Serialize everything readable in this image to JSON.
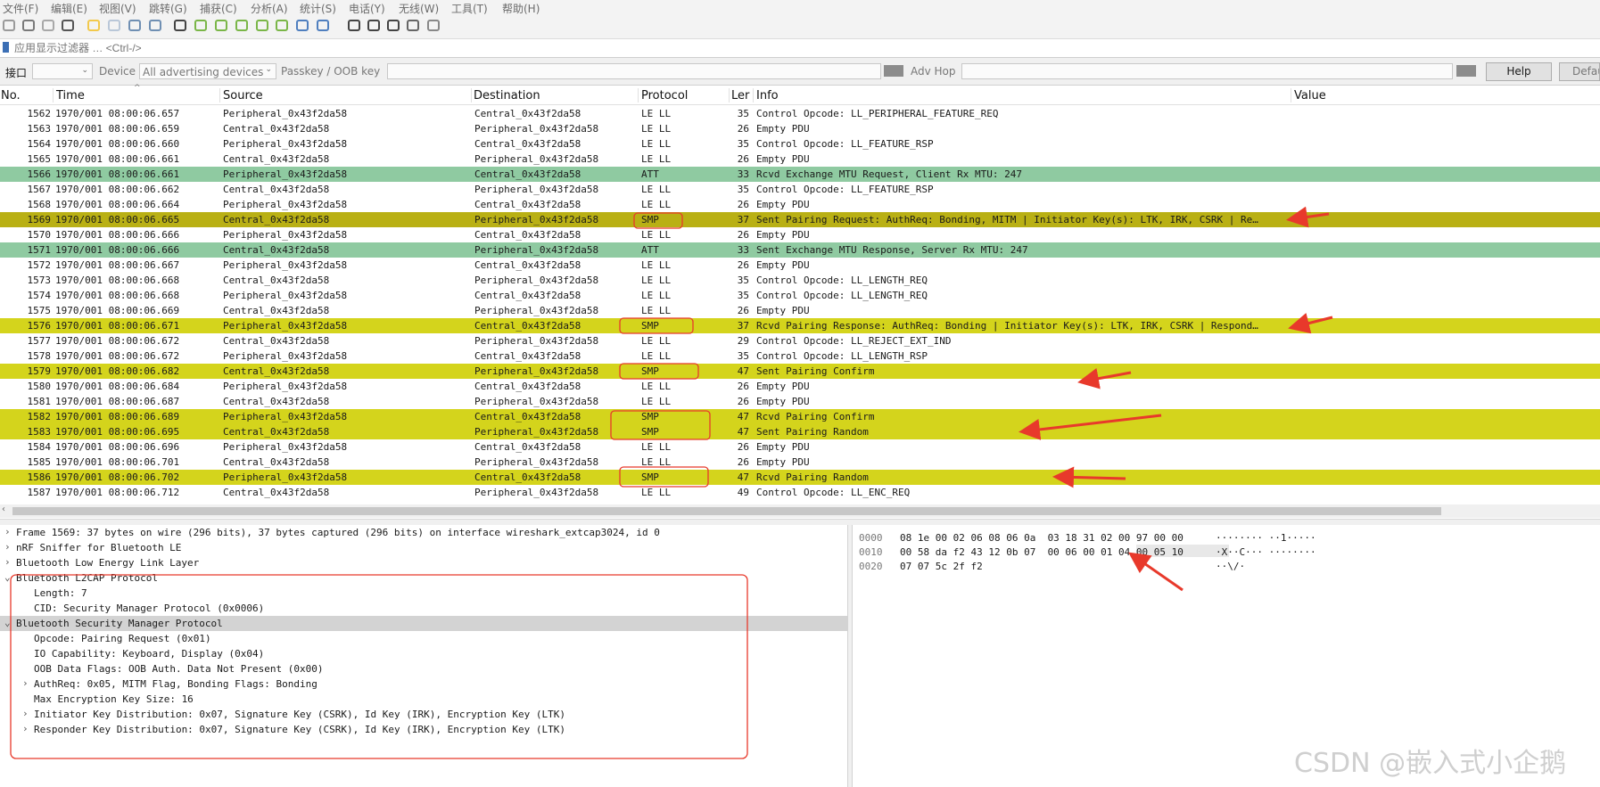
{
  "menu": [
    "文件(F)",
    "编辑(E)",
    "视图(V)",
    "跳转(G)",
    "捕获(C)",
    "分析(A)",
    "统计(S)",
    "电话(Y)",
    "无线(W)",
    "工具(T)",
    "帮助(H)"
  ],
  "toolbar_icons": [
    "start-capture-icon",
    "stop-capture-icon",
    "restart-capture-icon",
    "capture-options-icon",
    "open-file-icon",
    "save-file-icon",
    "close-file-icon",
    "reload-file-icon",
    "find-packet-icon",
    "go-back-icon",
    "go-forward-icon",
    "go-to-packet-icon",
    "first-packet-icon",
    "last-packet-icon",
    "autoscroll-icon",
    "colorize-icon",
    "zoom-in-icon",
    "zoom-out-icon",
    "zoom-normal-icon",
    "resize-columns-icon",
    "layout-icon"
  ],
  "filter": {
    "placeholder": "应用显示过滤器 … <Ctrl-/>"
  },
  "interface_bar": {
    "interface_label": "接口",
    "device_label": "Device",
    "device_value": "All advertising devices",
    "passkey_label": "Passkey / OOB key",
    "adv_hop_label": "Adv Hop",
    "help_label": "Help",
    "default_label": "Defau"
  },
  "columns": {
    "no": "No.",
    "time": "Time",
    "source": "Source",
    "destination": "Destination",
    "protocol": "Protocol",
    "length": "Ler",
    "info": "Info",
    "value": "Value"
  },
  "packets": [
    {
      "no": "1562",
      "time": "1970/001 08:00:06.657",
      "src": "Peripheral_0x43f2da58",
      "dst": "Central_0x43f2da58",
      "proto": "LE LL",
      "len": "35",
      "info": "Control Opcode: LL_PERIPHERAL_FEATURE_REQ",
      "color": "white"
    },
    {
      "no": "1563",
      "time": "1970/001 08:00:06.659",
      "src": "Central_0x43f2da58",
      "dst": "Peripheral_0x43f2da58",
      "proto": "LE LL",
      "len": "26",
      "info": "Empty PDU",
      "color": "white"
    },
    {
      "no": "1564",
      "time": "1970/001 08:00:06.660",
      "src": "Peripheral_0x43f2da58",
      "dst": "Central_0x43f2da58",
      "proto": "LE LL",
      "len": "35",
      "info": "Control Opcode: LL_FEATURE_RSP",
      "color": "white"
    },
    {
      "no": "1565",
      "time": "1970/001 08:00:06.661",
      "src": "Central_0x43f2da58",
      "dst": "Peripheral_0x43f2da58",
      "proto": "LE LL",
      "len": "26",
      "info": "Empty PDU",
      "color": "white"
    },
    {
      "no": "1566",
      "time": "1970/001 08:00:06.661",
      "src": "Peripheral_0x43f2da58",
      "dst": "Central_0x43f2da58",
      "proto": "ATT",
      "len": "33",
      "info": "Rcvd Exchange MTU Request, Client Rx MTU: 247",
      "color": "att"
    },
    {
      "no": "1567",
      "time": "1970/001 08:00:06.662",
      "src": "Central_0x43f2da58",
      "dst": "Peripheral_0x43f2da58",
      "proto": "LE LL",
      "len": "35",
      "info": "Control Opcode: LL_FEATURE_RSP",
      "color": "white"
    },
    {
      "no": "1568",
      "time": "1970/001 08:00:06.664",
      "src": "Peripheral_0x43f2da58",
      "dst": "Central_0x43f2da58",
      "proto": "LE LL",
      "len": "26",
      "info": "Empty PDU",
      "color": "white"
    },
    {
      "no": "1569",
      "time": "1970/001 08:00:06.665",
      "src": "Central_0x43f2da58",
      "dst": "Peripheral_0x43f2da58",
      "proto": "SMP",
      "len": "37",
      "info": "Sent Pairing Request: AuthReq: Bonding, MITM | Initiator Key(s): LTK, IRK, CSRK | Re…",
      "color": "sel"
    },
    {
      "no": "1570",
      "time": "1970/001 08:00:06.666",
      "src": "Peripheral_0x43f2da58",
      "dst": "Central_0x43f2da58",
      "proto": "LE LL",
      "len": "26",
      "info": "Empty PDU",
      "color": "white"
    },
    {
      "no": "1571",
      "time": "1970/001 08:00:06.666",
      "src": "Central_0x43f2da58",
      "dst": "Peripheral_0x43f2da58",
      "proto": "ATT",
      "len": "33",
      "info": "Sent Exchange MTU Response, Server Rx MTU: 247",
      "color": "att"
    },
    {
      "no": "1572",
      "time": "1970/001 08:00:06.667",
      "src": "Peripheral_0x43f2da58",
      "dst": "Central_0x43f2da58",
      "proto": "LE LL",
      "len": "26",
      "info": "Empty PDU",
      "color": "white"
    },
    {
      "no": "1573",
      "time": "1970/001 08:00:06.668",
      "src": "Central_0x43f2da58",
      "dst": "Peripheral_0x43f2da58",
      "proto": "LE LL",
      "len": "35",
      "info": "Control Opcode: LL_LENGTH_REQ",
      "color": "white"
    },
    {
      "no": "1574",
      "time": "1970/001 08:00:06.668",
      "src": "Peripheral_0x43f2da58",
      "dst": "Central_0x43f2da58",
      "proto": "LE LL",
      "len": "35",
      "info": "Control Opcode: LL_LENGTH_REQ",
      "color": "white"
    },
    {
      "no": "1575",
      "time": "1970/001 08:00:06.669",
      "src": "Central_0x43f2da58",
      "dst": "Peripheral_0x43f2da58",
      "proto": "LE LL",
      "len": "26",
      "info": "Empty PDU",
      "color": "white"
    },
    {
      "no": "1576",
      "time": "1970/001 08:00:06.671",
      "src": "Peripheral_0x43f2da58",
      "dst": "Central_0x43f2da58",
      "proto": "SMP",
      "len": "37",
      "info": "Rcvd Pairing Response: AuthReq: Bonding | Initiator Key(s): LTK, IRK, CSRK | Respond…",
      "color": "smp"
    },
    {
      "no": "1577",
      "time": "1970/001 08:00:06.672",
      "src": "Central_0x43f2da58",
      "dst": "Peripheral_0x43f2da58",
      "proto": "LE LL",
      "len": "29",
      "info": "Control Opcode: LL_REJECT_EXT_IND",
      "color": "white"
    },
    {
      "no": "1578",
      "time": "1970/001 08:00:06.672",
      "src": "Peripheral_0x43f2da58",
      "dst": "Central_0x43f2da58",
      "proto": "LE LL",
      "len": "35",
      "info": "Control Opcode: LL_LENGTH_RSP",
      "color": "white"
    },
    {
      "no": "1579",
      "time": "1970/001 08:00:06.682",
      "src": "Central_0x43f2da58",
      "dst": "Peripheral_0x43f2da58",
      "proto": "SMP",
      "len": "47",
      "info": "Sent Pairing Confirm",
      "color": "smp"
    },
    {
      "no": "1580",
      "time": "1970/001 08:00:06.684",
      "src": "Peripheral_0x43f2da58",
      "dst": "Central_0x43f2da58",
      "proto": "LE LL",
      "len": "26",
      "info": "Empty PDU",
      "color": "white"
    },
    {
      "no": "1581",
      "time": "1970/001 08:00:06.687",
      "src": "Central_0x43f2da58",
      "dst": "Peripheral_0x43f2da58",
      "proto": "LE LL",
      "len": "26",
      "info": "Empty PDU",
      "color": "white"
    },
    {
      "no": "1582",
      "time": "1970/001 08:00:06.689",
      "src": "Peripheral_0x43f2da58",
      "dst": "Central_0x43f2da58",
      "proto": "SMP",
      "len": "47",
      "info": "Rcvd Pairing Confirm",
      "color": "smp"
    },
    {
      "no": "1583",
      "time": "1970/001 08:00:06.695",
      "src": "Central_0x43f2da58",
      "dst": "Peripheral_0x43f2da58",
      "proto": "SMP",
      "len": "47",
      "info": "Sent Pairing Random",
      "color": "smp"
    },
    {
      "no": "1584",
      "time": "1970/001 08:00:06.696",
      "src": "Peripheral_0x43f2da58",
      "dst": "Central_0x43f2da58",
      "proto": "LE LL",
      "len": "26",
      "info": "Empty PDU",
      "color": "white"
    },
    {
      "no": "1585",
      "time": "1970/001 08:00:06.701",
      "src": "Central_0x43f2da58",
      "dst": "Peripheral_0x43f2da58",
      "proto": "LE LL",
      "len": "26",
      "info": "Empty PDU",
      "color": "white"
    },
    {
      "no": "1586",
      "time": "1970/001 08:00:06.702",
      "src": "Peripheral_0x43f2da58",
      "dst": "Central_0x43f2da58",
      "proto": "SMP",
      "len": "47",
      "info": "Rcvd Pairing Random",
      "color": "smp"
    },
    {
      "no": "1587",
      "time": "1970/001 08:00:06.712",
      "src": "Central_0x43f2da58",
      "dst": "Peripheral_0x43f2da58",
      "proto": "LE LL",
      "len": "49",
      "info": "Control Opcode: LL_ENC_REQ",
      "color": "white"
    }
  ],
  "details": [
    {
      "indent": 0,
      "expander": "›",
      "text": "Frame 1569: 37 bytes on wire (296 bits), 37 bytes captured (296 bits) on interface wireshark_extcap3024, id 0",
      "hl": false
    },
    {
      "indent": 0,
      "expander": "›",
      "text": "nRF Sniffer for Bluetooth LE",
      "hl": false
    },
    {
      "indent": 0,
      "expander": "›",
      "text": "Bluetooth Low Energy Link Layer",
      "hl": false
    },
    {
      "indent": 0,
      "expander": "⌄",
      "text": "Bluetooth L2CAP Protocol",
      "hl": false
    },
    {
      "indent": 1,
      "expander": "",
      "text": "Length: 7",
      "hl": false
    },
    {
      "indent": 1,
      "expander": "",
      "text": "CID: Security Manager Protocol (0x0006)",
      "hl": false
    },
    {
      "indent": 0,
      "expander": "⌄",
      "text": "Bluetooth Security Manager Protocol",
      "hl": true
    },
    {
      "indent": 1,
      "expander": "",
      "text": "Opcode: Pairing Request (0x01)",
      "hl": false
    },
    {
      "indent": 1,
      "expander": "",
      "text": "IO Capability: Keyboard, Display (0x04)",
      "hl": false
    },
    {
      "indent": 1,
      "expander": "",
      "text": "OOB Data Flags: OOB Auth. Data Not Present (0x00)",
      "hl": false
    },
    {
      "indent": 1,
      "expander": "›",
      "text": "AuthReq: 0x05, MITM Flag, Bonding Flags: Bonding",
      "hl": false
    },
    {
      "indent": 1,
      "expander": "",
      "text": "Max Encryption Key Size: 16",
      "hl": false
    },
    {
      "indent": 1,
      "expander": "›",
      "text": "Initiator Key Distribution: 0x07, Signature Key (CSRK), Id Key (IRK), Encryption Key (LTK)",
      "hl": false
    },
    {
      "indent": 1,
      "expander": "›",
      "text": "Responder Key Distribution: 0x07, Signature Key (CSRK), Id Key (IRK), Encryption Key (LTK)",
      "hl": false
    }
  ],
  "bytes": [
    {
      "offset": "0000",
      "hex": "08 1e 00 02 06 08 06 0a  03 18 31 02 00 97 00 00",
      "ascii": "········ ··1·····"
    },
    {
      "offset": "0010",
      "hex": "00 58 da f2 43 12 0b 07  00 06 00 01 04 00 05 10",
      "ascii": "·X··C··· ········"
    },
    {
      "offset": "0020",
      "hex": "07 07 5c 2f f2",
      "ascii": "··\\/·"
    }
  ],
  "watermark": "CSDN @嵌入式小企鹅",
  "colors": {
    "att": "#8fcaa1",
    "smp": "#d4d41c",
    "selected": "#b9b014",
    "annotation": "#e8392b"
  }
}
